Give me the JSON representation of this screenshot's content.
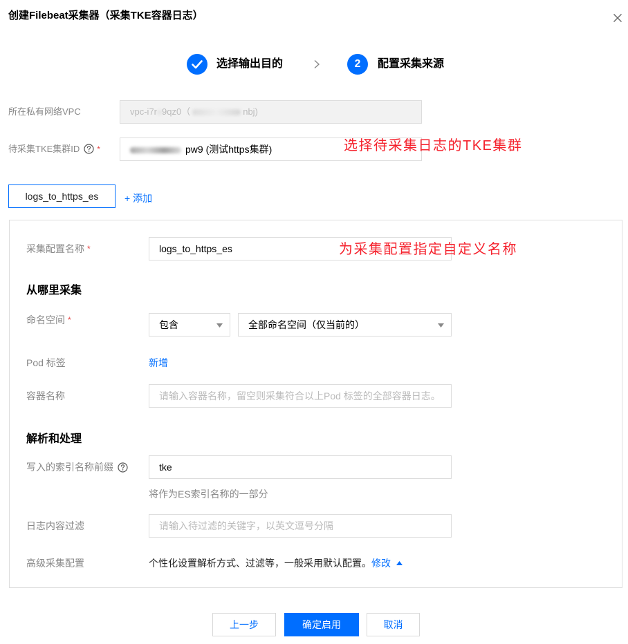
{
  "dialog": {
    "title": "创建Filebeat采集器（采集TKE容器日志）",
    "close_icon": "close-icon"
  },
  "steps": [
    {
      "label": "选择输出目的",
      "completed": true,
      "icon": "check-icon"
    },
    {
      "number": "2",
      "label": "配置采集来源",
      "completed": false
    }
  ],
  "step_separator_icon": "chevron-right-icon",
  "vpc": {
    "label": "所在私有网络VPC",
    "value_part1": "vpc-i7r",
    "value_part2": "9qz0（",
    "value_part3": "nbj)",
    "disabled": true
  },
  "cluster": {
    "label": "待采集TKE集群ID",
    "help_icon": "help-icon",
    "required_mark": "*",
    "value_visible": "pw9 (测试https集群)"
  },
  "annotations": {
    "cluster": "选择待采集日志的TKE集群",
    "config_name": "为采集配置指定自定义名称",
    "color": "#f5222d"
  },
  "config_tabs": {
    "items": [
      "logs_to_https_es"
    ],
    "add_label": "+ 添加"
  },
  "config": {
    "name": {
      "label": "采集配置名称",
      "required_mark": "*",
      "value": "logs_to_https_es"
    },
    "source_section": "从哪里采集",
    "namespace": {
      "label": "命名空间",
      "required_mark": "*",
      "mode": "包含",
      "scope": "全部命名空间（仅当前的）",
      "dropdown_icon": "caret-down-icon"
    },
    "pod_labels": {
      "label": "Pod 标签",
      "add_label": "新增"
    },
    "container_name": {
      "label": "容器名称",
      "placeholder": "请输入容器名称，留空则采集符合以上Pod 标签的全部容器日志。"
    },
    "parse_section": "解析和处理",
    "index_prefix": {
      "label": "写入的索引名称前缀",
      "help_icon": "help-icon",
      "value": "tke",
      "hint": "将作为ES索引名称的一部分"
    },
    "content_filter": {
      "label": "日志内容过滤",
      "placeholder": "请输入待过滤的关键字，以英文逗号分隔"
    },
    "advanced": {
      "label": "高级采集配置",
      "description": "个性化设置解析方式、过滤等，一般采用默认配置。",
      "edit_label": "修改",
      "toggle_icon": "caret-up-icon"
    }
  },
  "footer": {
    "prev_label": "上一步",
    "confirm_label": "确定启用",
    "cancel_label": "取消"
  },
  "colors": {
    "primary": "#006eff",
    "required": "#e54545",
    "border": "#dddddd",
    "label": "#888888"
  }
}
